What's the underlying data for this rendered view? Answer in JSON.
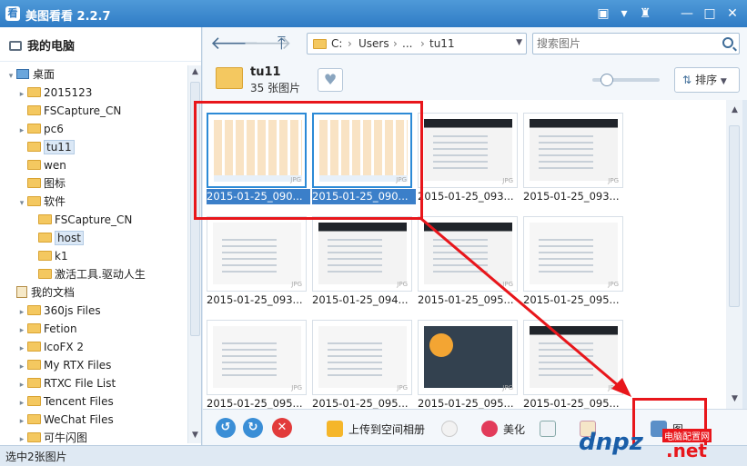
{
  "app": {
    "title": "美图看看 2.2.7",
    "logo": "看"
  },
  "window_controls": [
    "speech-icon",
    "menu-icon",
    "shirt-icon",
    "minimize-icon",
    "maximize-icon",
    "close-icon"
  ],
  "sidebar": {
    "header": "我的电脑",
    "tree": [
      {
        "label": "桌面",
        "level": 0,
        "icon": "desktop",
        "arrow": "▾"
      },
      {
        "label": "2015123",
        "level": 1,
        "icon": "folder",
        "arrow": "▸"
      },
      {
        "label": "FSCapture_CN",
        "level": 1,
        "icon": "folder",
        "arrow": ""
      },
      {
        "label": "pc6",
        "level": 1,
        "icon": "folder",
        "arrow": "▸"
      },
      {
        "label": "tu11",
        "level": 1,
        "icon": "folder",
        "arrow": "",
        "selected": true
      },
      {
        "label": "wen",
        "level": 1,
        "icon": "folder",
        "arrow": ""
      },
      {
        "label": "图标",
        "level": 1,
        "icon": "folder",
        "arrow": ""
      },
      {
        "label": "软件",
        "level": 1,
        "icon": "folder",
        "arrow": "▾"
      },
      {
        "label": "FSCapture_CN",
        "level": 2,
        "icon": "folder",
        "arrow": ""
      },
      {
        "label": "host",
        "level": 2,
        "icon": "folder",
        "arrow": "",
        "boxed": true
      },
      {
        "label": "k1",
        "level": 2,
        "icon": "folder",
        "arrow": ""
      },
      {
        "label": "激活工具.驱动人生",
        "level": 2,
        "icon": "folder",
        "arrow": ""
      },
      {
        "label": "我的文档",
        "level": 0,
        "icon": "doc",
        "arrow": ""
      },
      {
        "label": "360js Files",
        "level": 1,
        "icon": "folder",
        "arrow": "▸"
      },
      {
        "label": "Fetion",
        "level": 1,
        "icon": "folder",
        "arrow": "▸"
      },
      {
        "label": "IcoFX 2",
        "level": 1,
        "icon": "folder",
        "arrow": "▸"
      },
      {
        "label": "My RTX Files",
        "level": 1,
        "icon": "folder",
        "arrow": "▸"
      },
      {
        "label": "RTXC File List",
        "level": 1,
        "icon": "folder",
        "arrow": "▸"
      },
      {
        "label": "Tencent Files",
        "level": 1,
        "icon": "folder",
        "arrow": "▸"
      },
      {
        "label": "WeChat Files",
        "level": 1,
        "icon": "folder",
        "arrow": "▸"
      },
      {
        "label": "可牛闪图",
        "level": 1,
        "icon": "folder",
        "arrow": "▸"
      }
    ]
  },
  "toolbar": {
    "path": [
      "C:",
      "Users",
      "...",
      "tu11"
    ],
    "search_placeholder": "搜索图片"
  },
  "folder_info": {
    "name": "tu11",
    "count": "35 张图片",
    "sort_label": "排序",
    "zoom_level": 0.12
  },
  "thumbnails": [
    {
      "caption": "2015-01-25_090...",
      "selected": true,
      "style": "cartoon"
    },
    {
      "caption": "2015-01-25_090...",
      "selected": true,
      "style": "cartoon"
    },
    {
      "caption": "2015-01-25_093...",
      "selected": false,
      "style": "dark-top"
    },
    {
      "caption": "2015-01-25_093...",
      "selected": false,
      "style": "dark-top"
    },
    {
      "caption": "2015-01-25_093...",
      "selected": false,
      "style": "plain"
    },
    {
      "caption": "2015-01-25_094...",
      "selected": false,
      "style": "dark-top"
    },
    {
      "caption": "2015-01-25_095...",
      "selected": false,
      "style": "dark-top"
    },
    {
      "caption": "2015-01-25_095...",
      "selected": false,
      "style": "plain"
    },
    {
      "caption": "2015-01-25_095...",
      "selected": false,
      "style": "plain"
    },
    {
      "caption": "2015-01-25_095...",
      "selected": false,
      "style": "plain"
    },
    {
      "caption": "2015-01-25_095...",
      "selected": false,
      "style": "dark"
    },
    {
      "caption": "2015-01-25_095...",
      "selected": false,
      "style": "dark-top"
    }
  ],
  "thumb_tag": "JPG",
  "bottombar": {
    "upload": "上传到空间相册",
    "beautify": "美化",
    "slideshow_hint": "",
    "more_label": "图"
  },
  "status": {
    "text": "选中2张图片"
  },
  "watermark": {
    "logo": "dnpz",
    "net": ".net",
    "sub": "电脑配置网"
  },
  "colors": {
    "title_bar": "#2f7cc5",
    "selection": "#3b7fc9",
    "annotation": "#e8161b"
  }
}
